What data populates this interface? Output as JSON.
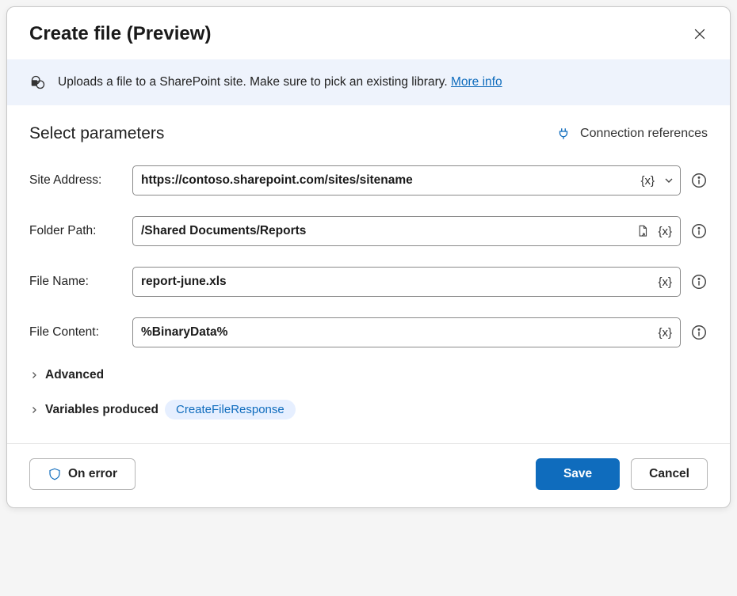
{
  "dialog": {
    "title": "Create file (Preview)"
  },
  "banner": {
    "text": "Uploads a file to a SharePoint site. Make sure to pick an existing library. ",
    "link": "More info"
  },
  "section": {
    "title": "Select parameters",
    "conn_ref": "Connection references"
  },
  "fields": {
    "site_address": {
      "label": "Site Address:",
      "value": "https://contoso.sharepoint.com/sites/sitename"
    },
    "folder_path": {
      "label": "Folder Path:",
      "value": "/Shared Documents/Reports"
    },
    "file_name": {
      "label": "File Name:",
      "value": "report-june.xls"
    },
    "file_content": {
      "label": "File Content:",
      "value": "%BinaryData%"
    }
  },
  "token_label": "{x}",
  "advanced": {
    "label": "Advanced"
  },
  "variables": {
    "label": "Variables produced",
    "tag": "CreateFileResponse"
  },
  "footer": {
    "on_error": "On error",
    "save": "Save",
    "cancel": "Cancel"
  }
}
